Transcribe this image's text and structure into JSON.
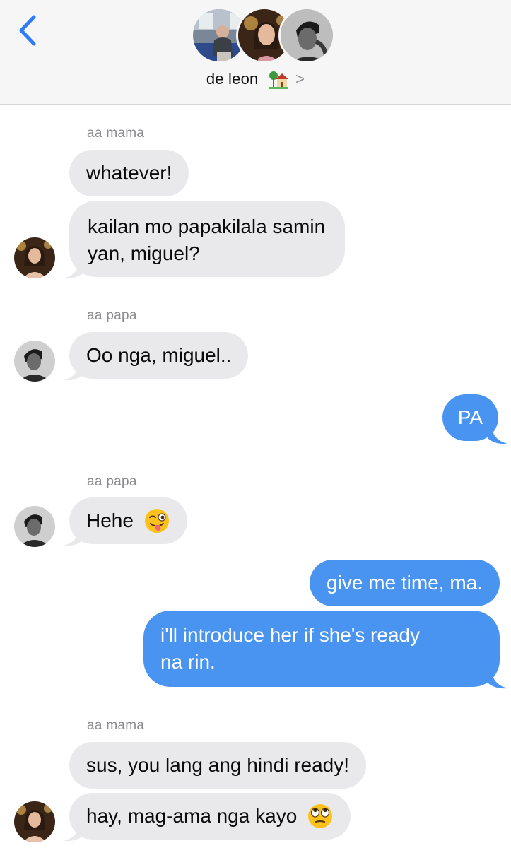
{
  "header": {
    "title": "de leon",
    "title_emoji": "house-with-garden-emoji",
    "chevron": ">"
  },
  "messages": [
    {
      "sender": "aa mama",
      "text": "whatever!"
    },
    {
      "text_line1": "kailan mo papakilala samin",
      "text_line2": "yan, miguel?"
    },
    {
      "sender": "aa papa",
      "text": "Oo nga, miguel.."
    },
    {
      "text": "PA"
    },
    {
      "sender": "aa papa",
      "text": "Hehe"
    },
    {
      "text": "give me time, ma."
    },
    {
      "text_line1": "i'll introduce her if she's ready",
      "text_line2": "na rin."
    },
    {
      "sender": "aa mama",
      "text": "sus, you lang ang hindi ready!"
    },
    {
      "text": "hay, mag-ama nga kayo"
    }
  ],
  "colors": {
    "incoming_bubble": "#e9e9eb",
    "outgoing_bubble": "#4a94f1",
    "accent": "#2f7cf6",
    "header_bg": "#f6f6f7"
  }
}
